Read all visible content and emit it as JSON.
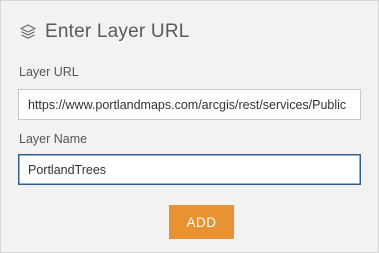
{
  "header": {
    "title": "Enter Layer URL",
    "icon": "layers-icon"
  },
  "form": {
    "url_label": "Layer URL",
    "url_value": "https://www.portlandmaps.com/arcgis/rest/services/Public",
    "name_label": "Layer Name",
    "name_value": "PortlandTrees"
  },
  "actions": {
    "add_label": "ADD"
  },
  "colors": {
    "panel_background": "#f2f2f2",
    "accent_button": "#e99232",
    "focus_border": "#2f5f8f"
  }
}
